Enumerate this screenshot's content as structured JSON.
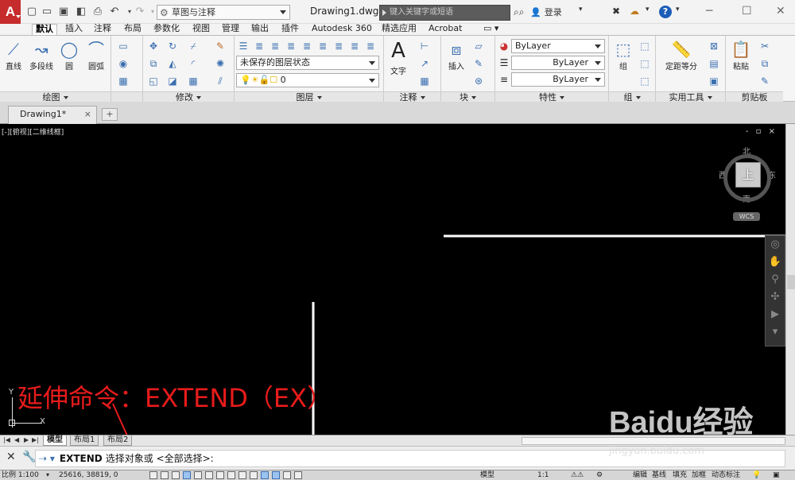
{
  "titlebar": {
    "app_logo": "A",
    "workspace": "草图与注释",
    "document_title": "Drawing1.dwg",
    "search_placeholder": "键入关键字或短语",
    "login": "登录",
    "help": "?",
    "icons": [
      "new-icon",
      "open-icon",
      "save-icon",
      "saveas-icon",
      "print-icon",
      "undo-icon",
      "redo-icon",
      "binoculars-icon",
      "user-icon",
      "exchange-icon",
      "autodesk-360-icon",
      "help-icon"
    ]
  },
  "ribbon_tabs": [
    "默认",
    "插入",
    "注释",
    "布局",
    "参数化",
    "视图",
    "管理",
    "输出",
    "插件",
    "Autodesk 360",
    "精选应用",
    "Acrobat"
  ],
  "ribbon_tab_active": "默认",
  "panels": {
    "draw": {
      "title": "绘图",
      "tools": [
        "直线",
        "多段线",
        "圆",
        "圆弧"
      ]
    },
    "modify": {
      "title": "修改"
    },
    "layer": {
      "title": "图层",
      "state": "未保存的图层状态",
      "current": "0"
    },
    "annotation": {
      "title": "注释",
      "tool": "文字"
    },
    "block": {
      "title": "块",
      "tool": "插入"
    },
    "properties": {
      "title": "特性",
      "color": "ByLayer",
      "linetype": "ByLayer",
      "lineweight": "ByLayer"
    },
    "group": {
      "title": "组",
      "tool": "组"
    },
    "utilities": {
      "title": "实用工具",
      "tool": "定距等分"
    },
    "clipboard": {
      "title": "剪贴板",
      "tool": "粘贴"
    }
  },
  "file_tab": "Drawing1*",
  "viewport": {
    "label": "[-][俯视][二维线框]",
    "controls": "- ▫ ×",
    "viewcube": {
      "north": "北",
      "south": "南",
      "east": "东",
      "west": "西",
      "top": "上",
      "wcs": "WCS"
    },
    "ucs": {
      "x": "X",
      "y": "Y"
    },
    "annotation_text": "延伸命令：EXTEND（EX）"
  },
  "layout_tabs": [
    "模型",
    "布局1",
    "布局2"
  ],
  "command": {
    "prompt": "⇢ ▾",
    "name": "EXTEND",
    "text": "选择对象或 <全部选择>:"
  },
  "statusbar": {
    "scale": "比例 1:100",
    "coords": "25616, 38819, 0",
    "model": "模型",
    "anno_scale": "1:1",
    "right_buttons": [
      "编辑",
      "基线",
      "填充",
      "加框",
      "动态标注"
    ]
  },
  "watermark": {
    "text": "Baidu经验",
    "url": "jingyan.baidu.com"
  },
  "colors": {
    "accent": "#3a6fb0",
    "logo": "#c72c2c",
    "annotation": "#e81b1b",
    "canvas": "#000000"
  }
}
